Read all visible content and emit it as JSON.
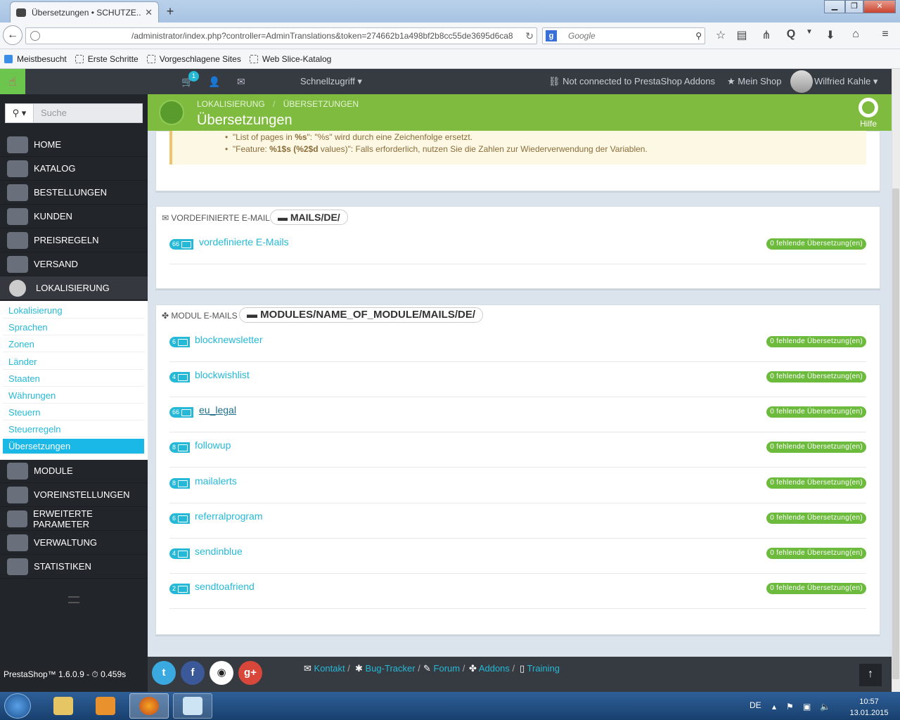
{
  "browser": {
    "tab_title": "Übersetzungen • SCHUTZE...",
    "url": "/administrator/index.php?controller=AdminTranslations&token=274662b1a498bf2b8cc55de3695d6ca8",
    "search_placeholder": "Google",
    "bookmarks": [
      "Meistbesucht",
      "Erste Schritte",
      "Vorgeschlagene Sites",
      "Web Slice-Katalog"
    ]
  },
  "header": {
    "cart_count": "1",
    "quick_access": "Schnellzugriff",
    "not_connected": "Not connected to PrestaShop Addons",
    "my_shop": "Mein Shop",
    "user_name": "Wilfried Kahle"
  },
  "sidebar": {
    "search_placeholder": "Suche",
    "items": [
      "HOME",
      "KATALOG",
      "BESTELLUNGEN",
      "KUNDEN",
      "PREISREGELN",
      "VERSAND",
      "LOKALISIERUNG",
      "MODULE",
      "VOREINSTELLUNGEN",
      "ERWEITERTE PARAMETER",
      "VERWALTUNG",
      "STATISTIKEN"
    ],
    "subitems": [
      "Lokalisierung",
      "Sprachen",
      "Zonen",
      "Länder",
      "Staaten",
      "Währungen",
      "Steuern",
      "Steuerregeln",
      "Übersetzungen"
    ]
  },
  "page": {
    "breadcrumb_1": "LOKALISIERUNG",
    "breadcrumb_sep": "/",
    "breadcrumb_2": "ÜBERSETZUNGEN",
    "title": "Übersetzungen",
    "help": "Hilfe"
  },
  "warning": {
    "line1_pre": "\"List of pages in ",
    "line1_bold": "%s",
    "line1_post": "\": \"%s\" wird durch eine Zeichenfolge ersetzt.",
    "line2_pre": "\"Feature: ",
    "line2_bold": "%1$s (%2$d",
    "line2_post": " values)\": Falls erforderlich, nutzen Sie die Zahlen zur Wiederverwendung der Variablen."
  },
  "predefined": {
    "heading": "VORDEFINIERTE E-MAILS",
    "path": "MAILS/DE/",
    "rows": [
      {
        "count": "66",
        "name": "vordefinierte E-Mails",
        "status": "0 fehlende Übersetzung(en)"
      }
    ]
  },
  "modules": {
    "heading": "MODUL E-MAILS",
    "path": "MODULES/NAME_OF_MODULE/MAILS/DE/",
    "rows": [
      {
        "count": "6",
        "name": "blocknewsletter",
        "status": "0 fehlende Übersetzung(en)"
      },
      {
        "count": "4",
        "name": "blockwishlist",
        "status": "0 fehlende Übersetzung(en)"
      },
      {
        "count": "66",
        "name": "eu_legal",
        "status": "0 fehlende Übersetzung(en)"
      },
      {
        "count": "8",
        "name": "followup",
        "status": "0 fehlende Übersetzung(en)"
      },
      {
        "count": "8",
        "name": "mailalerts",
        "status": "0 fehlende Übersetzung(en)"
      },
      {
        "count": "6",
        "name": "referralprogram",
        "status": "0 fehlende Übersetzung(en)"
      },
      {
        "count": "4",
        "name": "sendinblue",
        "status": "0 fehlende Übersetzung(en)"
      },
      {
        "count": "2",
        "name": "sendtoafriend",
        "status": "0 fehlende Übersetzung(en)"
      }
    ]
  },
  "footer": {
    "version": "PrestaShop™ 1.6.0.9 - ",
    "load_time": "0.459s",
    "links": [
      "Kontakt",
      "Bug-Tracker",
      "Forum",
      "Addons",
      "Training"
    ]
  },
  "taskbar": {
    "lang": "DE",
    "time": "10:57",
    "date": "13.01.2015"
  },
  "colors": {
    "accent": "#25b9d7",
    "green": "#7fbb3e",
    "dark": "#363a41",
    "status_green": "#6cbb3c"
  }
}
